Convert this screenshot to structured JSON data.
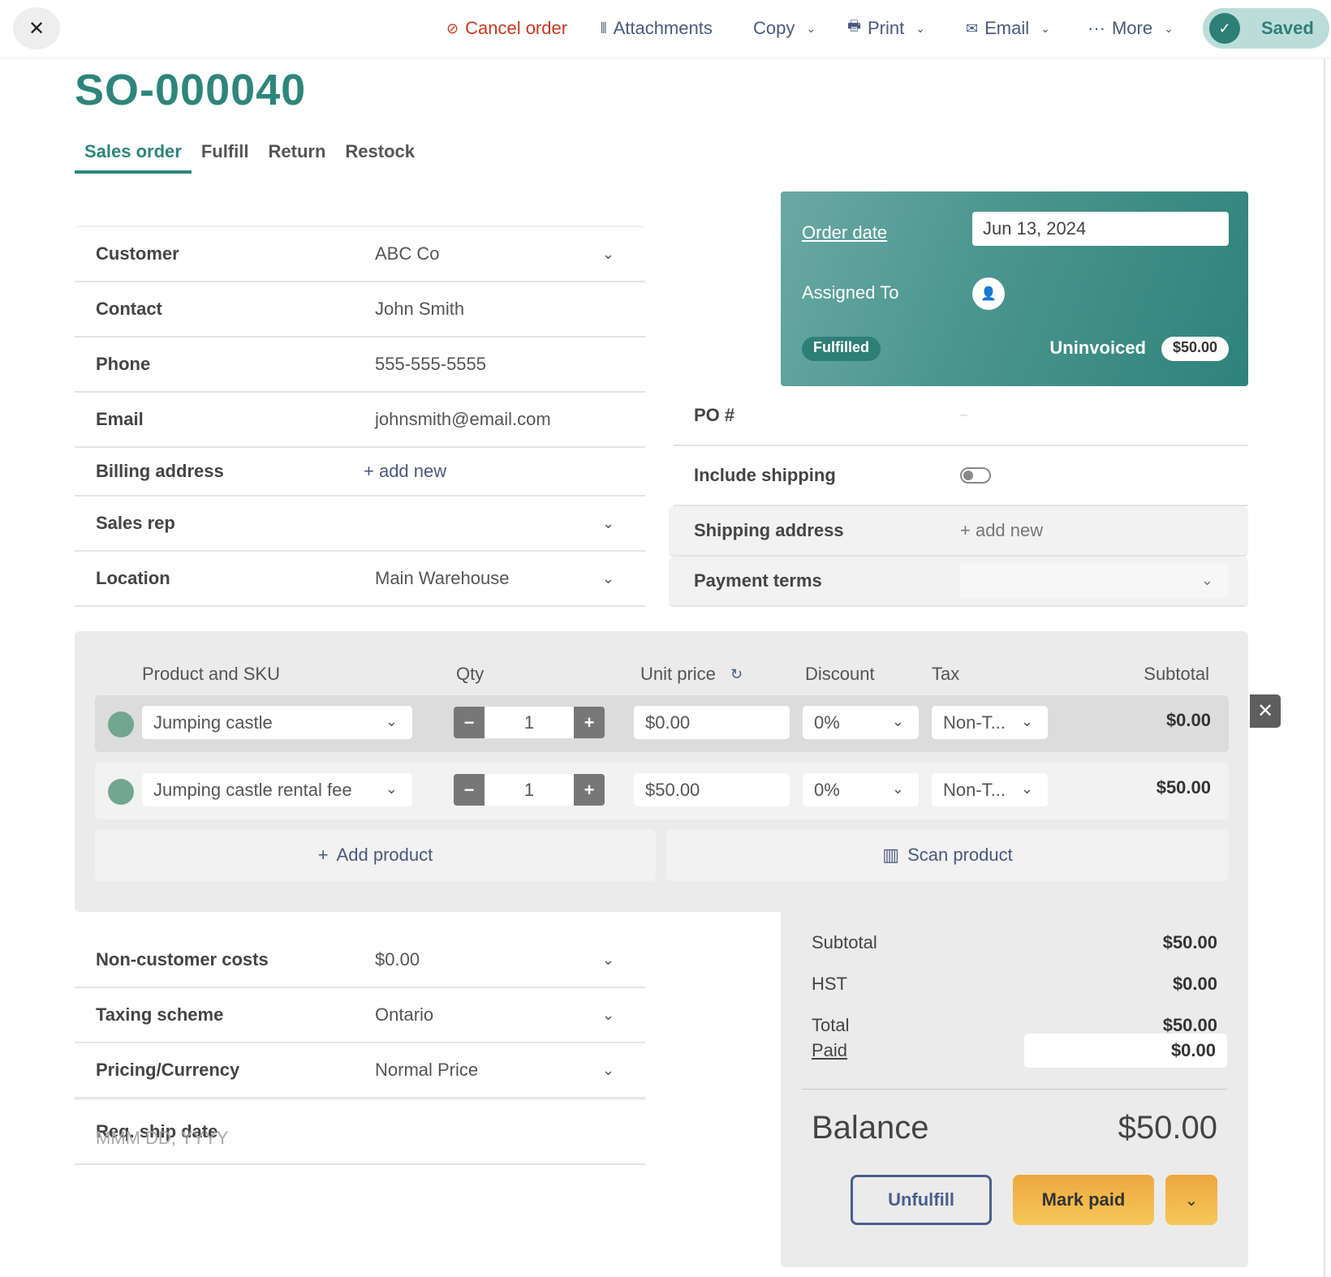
{
  "header": {
    "close_label": "×",
    "cancel_order": "Cancel order",
    "attachments": "Attachments",
    "copy": "Copy",
    "print": "Print",
    "email": "Email",
    "more": "More",
    "saved": "Saved"
  },
  "icons": {
    "close": "✕",
    "cancel": "⊘",
    "attachment": "⫴",
    "print": "🖶",
    "email": "✉",
    "more": "···",
    "chevron": "⌄",
    "check": "✓",
    "refresh": "↻",
    "barcode": "▥",
    "user": "👤",
    "remove": "✕"
  },
  "title": "SO-000040",
  "tabs": [
    {
      "label": "Sales order",
      "active": true
    },
    {
      "label": "Fulfill",
      "active": false
    },
    {
      "label": "Return",
      "active": false
    },
    {
      "label": "Restock",
      "active": false
    }
  ],
  "left_form": [
    {
      "label": "Customer",
      "value": "ABC Co",
      "dropdown": true
    },
    {
      "label": "Contact",
      "value": "John Smith"
    },
    {
      "label": "Phone",
      "value": "555-555-5555"
    },
    {
      "label": "Email",
      "value": "johnsmith@email.com"
    },
    {
      "label": "Billing address",
      "value": "+ add new"
    },
    {
      "label": "Sales rep",
      "value": "",
      "dropdown": true
    },
    {
      "label": "Location",
      "value": "Main Warehouse",
      "dropdown": true
    }
  ],
  "status_panel": {
    "order_date_label": "Order date",
    "order_date": "Jun 13, 2024",
    "assigned_to_label": "Assigned To",
    "fulfilled_badge": "Fulfilled",
    "uninvoiced_label": "Uninvoiced",
    "uninvoiced_amount": "$50.00",
    "accent_color": "#2e857b"
  },
  "right_form": {
    "po_label": "PO #",
    "po_value": "–",
    "include_shipping_label": "Include shipping",
    "include_shipping": false,
    "shipping_address_label": "Shipping address",
    "shipping_address_value": "+ add new",
    "payment_terms_label": "Payment terms",
    "payment_terms_value": ""
  },
  "products": {
    "columns": {
      "product": "Product and SKU",
      "qty": "Qty",
      "unit_price": "Unit price",
      "discount": "Discount",
      "tax": "Tax",
      "subtotal": "Subtotal"
    },
    "rows": [
      {
        "product": "Jumping castle",
        "qty": "1",
        "unit_price": "$0.00",
        "discount": "0%",
        "tax": "Non-T...",
        "subtotal": "$0.00"
      },
      {
        "product": "Jumping castle rental fee",
        "qty": "1",
        "unit_price": "$50.00",
        "discount": "0%",
        "tax": "Non-T...",
        "subtotal": "$50.00"
      }
    ],
    "add_product": "Add product",
    "scan_product": "Scan product",
    "minus": "−",
    "plus": "+"
  },
  "bottom_form": [
    {
      "label": "Non-customer costs",
      "value": "$0.00",
      "dropdown": true
    },
    {
      "label": "Taxing scheme",
      "value": "Ontario",
      "dropdown": true
    },
    {
      "label": "Pricing/Currency",
      "value": "Normal Price",
      "dropdown": true
    },
    {
      "label": "Req. ship date",
      "placeholder": "MMM DD, YYYY"
    }
  ],
  "totals": {
    "subtotal_label": "Subtotal",
    "subtotal": "$50.00",
    "hst_label": "HST",
    "hst": "$0.00",
    "total_label": "Total",
    "total": "$50.00",
    "paid_label": "Paid",
    "paid": "$0.00",
    "balance_label": "Balance",
    "balance": "$50.00"
  },
  "actions": {
    "unfulfill": "Unfulfill",
    "mark_paid": "Mark paid"
  }
}
